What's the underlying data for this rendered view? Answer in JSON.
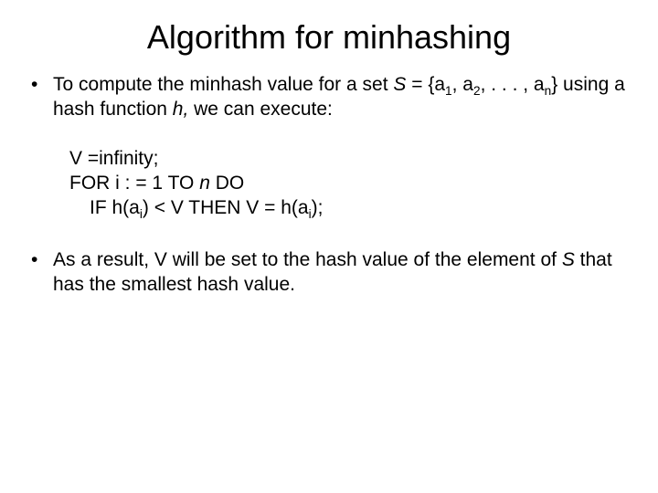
{
  "title": "Algorithm for minhashing",
  "bullets": {
    "b1": {
      "t1": "To compute the minhash value for a set ",
      "s": "S",
      "eq": " = {a",
      "sub1": "1",
      "c1": ", a",
      "sub2": "2",
      "c2": ", . . . , a",
      "subn": "n",
      "close": "} using a hash function ",
      "h": "h,",
      "tail": " we can execute:"
    },
    "code": {
      "l1": "V =infinity;",
      "l2a": "FOR i : = 1 TO ",
      "l2n": "n",
      "l2b": " DO",
      "l3a": "IF h(a",
      "l3i1": "i",
      "l3b": ") < V THEN V = h(a",
      "l3i2": "i",
      "l3c": ");"
    },
    "b2": {
      "t1": "As a result, V will be set to the hash value of the element of ",
      "s": "S",
      "t2": " that has the smallest hash value."
    }
  }
}
